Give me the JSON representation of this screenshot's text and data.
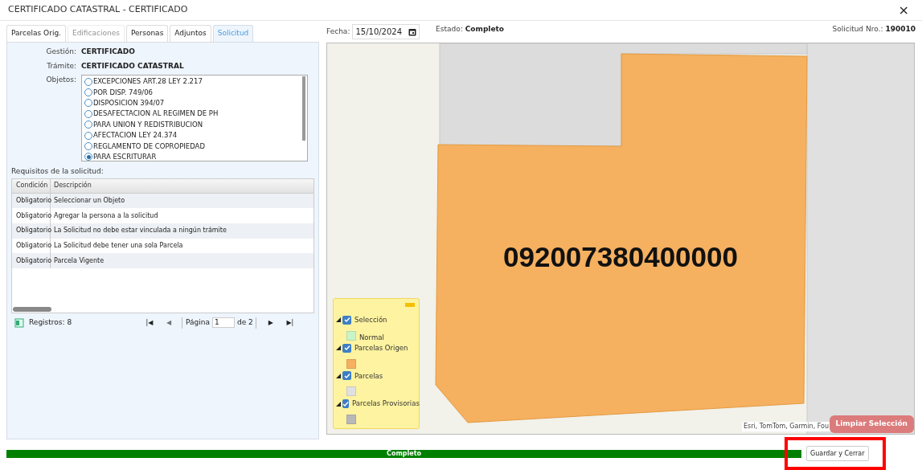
{
  "window": {
    "title": "CERTIFICADO CATASTRAL - CERTIFICADO",
    "close": "×"
  },
  "tabs": [
    {
      "label": "Parcelas Orig.",
      "selected": false,
      "disabled": false
    },
    {
      "label": "Edificaciones",
      "selected": false,
      "disabled": true
    },
    {
      "label": "Personas",
      "selected": false,
      "disabled": false
    },
    {
      "label": "Adjuntos",
      "selected": false,
      "disabled": false
    },
    {
      "label": "Solicitud",
      "selected": true,
      "disabled": false
    }
  ],
  "form": {
    "gestion_label": "Gestión:",
    "gestion": "CERTIFICADO",
    "tramite_label": "Trámite:",
    "tramite": "CERTIFICADO CATASTRAL",
    "objetos_label": "Objetos:",
    "objetos": [
      {
        "label": "EXCEPCIONES ART.28 LEY 2.217",
        "selected": false
      },
      {
        "label": "POR DISP. 749/06",
        "selected": false
      },
      {
        "label": "DISPOSICION 394/07",
        "selected": false
      },
      {
        "label": "DESAFECTACION AL REGIMEN DE PH",
        "selected": false
      },
      {
        "label": "PARA UNION Y REDISTRIBUCION",
        "selected": false
      },
      {
        "label": "AFECTACION LEY 24.374",
        "selected": false
      },
      {
        "label": "REGLAMENTO DE COPROPIEDAD",
        "selected": false
      },
      {
        "label": "PARA ESCRITURAR",
        "selected": true
      }
    ]
  },
  "requisitos": {
    "title": "Requisitos de la solicitud:",
    "columns": [
      "Condición",
      "Descripción"
    ],
    "rows": [
      [
        "Obligatorio",
        "Seleccionar un Objeto"
      ],
      [
        "Obligatorio",
        "Agregar la persona a la solicitud"
      ],
      [
        "Obligatorio",
        "La Solicitud no debe estar vinculada a ningún trámite"
      ],
      [
        "Obligatorio",
        "La Solicitud debe tener una sola Parcela"
      ],
      [
        "Obligatorio",
        "Parcela Vigente"
      ]
    ],
    "registros": "Registros: 8",
    "pager": [
      "|◀",
      "◀",
      "▶",
      "▶|"
    ],
    "pagina_label": "Página",
    "pagina": "1",
    "de": "de 2"
  },
  "header": {
    "fecha_label": "Fecha:",
    "fecha": "15/10/2024",
    "estado_label": "Estado:",
    "estado": "Completo",
    "solicitud_label": "Solicitud Nro.:",
    "solicitud": "190010"
  },
  "map": {
    "parcel_label": "092007380400000",
    "attribution": "Esri, TomTom, Garmin, Fou",
    "clear_button": "Limpiar Selección",
    "legend": [
      {
        "label": "Selección",
        "checked": true,
        "symbols": [
          {
            "label": "Normal",
            "color": "#c8f5c8"
          }
        ]
      },
      {
        "label": "Parcelas Origen",
        "checked": true,
        "symbols": [
          {
            "color": "#f5b060"
          }
        ]
      },
      {
        "label": "Parcelas",
        "checked": true,
        "symbols": [
          {
            "color": "#e0e0e0"
          }
        ]
      },
      {
        "label": "Parcelas Provisorias",
        "checked": true,
        "symbols": [
          {
            "color": "#b8b8b8"
          }
        ]
      }
    ]
  },
  "progress": {
    "label": "Completo"
  },
  "buttons": [
    "Guardar y Cerrar"
  ]
}
